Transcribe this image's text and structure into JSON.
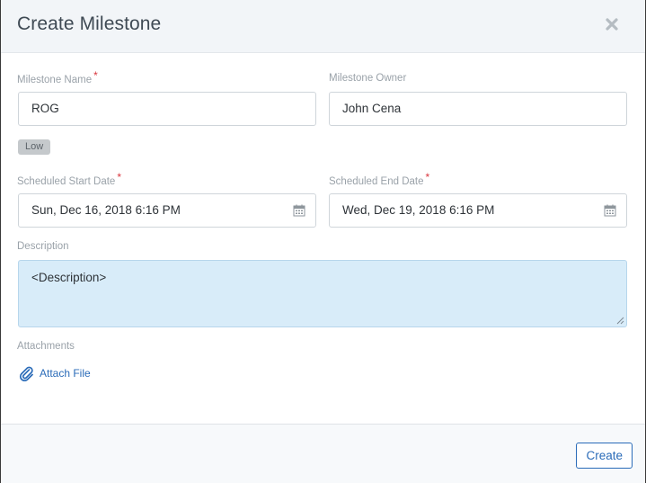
{
  "dialog": {
    "title": "Create Milestone"
  },
  "form": {
    "milestone_name": {
      "label": "Milestone Name",
      "required_mark": "*",
      "value": "ROG"
    },
    "milestone_owner": {
      "label": "Milestone Owner",
      "value": "John Cena"
    },
    "priority_badge": "Low",
    "start_date": {
      "label": "Scheduled Start Date",
      "required_mark": "*",
      "value": "Sun, Dec 16, 2018 6:16 PM"
    },
    "end_date": {
      "label": "Scheduled End Date",
      "required_mark": "*",
      "value": "Wed, Dec 19, 2018 6:16 PM"
    },
    "description": {
      "label": "Description",
      "value": "<Description>"
    },
    "attachments": {
      "label": "Attachments",
      "link_label": "Attach File"
    }
  },
  "footer": {
    "create_label": "Create"
  },
  "icons": {
    "close": "close-icon",
    "calendar": "calendar-icon",
    "attach": "paperclip-icon"
  },
  "colors": {
    "accent": "#2a6bb8",
    "required": "#d9363e",
    "description_bg": "#d8ecf9"
  }
}
